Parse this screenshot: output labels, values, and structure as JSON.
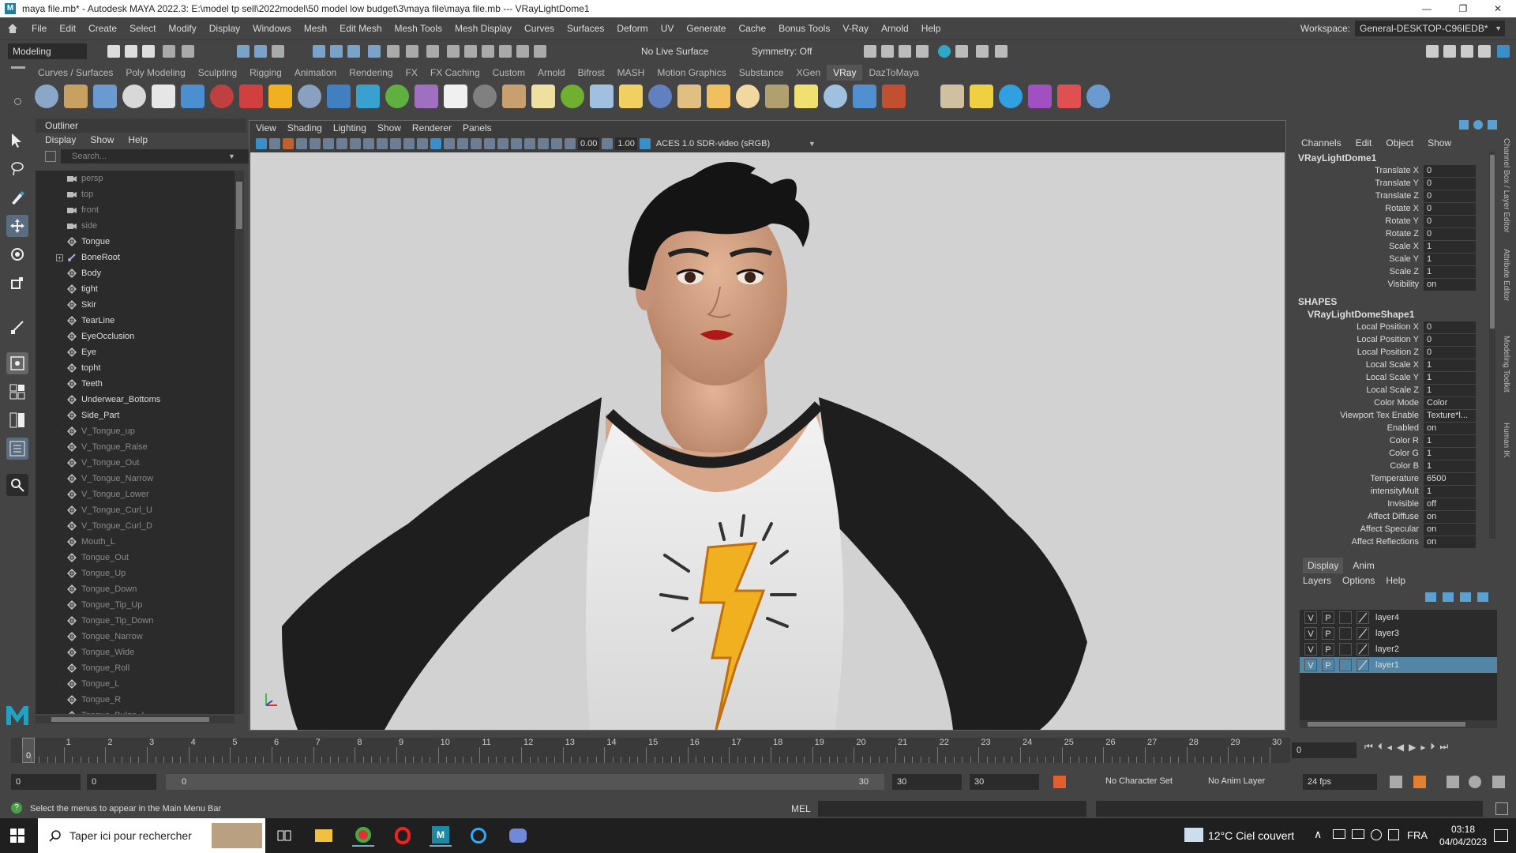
{
  "window": {
    "title": "maya file.mb* - Autodesk MAYA 2022.3: E:\\model tp sell\\2022model\\50 model low budget\\3\\maya file\\maya file.mb  ---  VRayLightDome1",
    "minimize": "—",
    "maximize": "❐",
    "close": "✕"
  },
  "menubar": {
    "items": [
      "File",
      "Edit",
      "Create",
      "Select",
      "Modify",
      "Display",
      "Windows",
      "Mesh",
      "Edit Mesh",
      "Mesh Tools",
      "Mesh Display",
      "Curves",
      "Surfaces",
      "Deform",
      "UV",
      "Generate",
      "Cache",
      "Bonus Tools",
      "V-Ray",
      "Arnold",
      "Help"
    ],
    "workspace_label": "Workspace:",
    "workspace_value": "General-DESKTOP-C96IEDB*"
  },
  "statusline": {
    "menuset": "Modeling",
    "live_surface": "No Live Surface",
    "symmetry": "Symmetry: Off"
  },
  "shelf": {
    "tabs": [
      "Curves / Surfaces",
      "Poly Modeling",
      "Sculpting",
      "Rigging",
      "Animation",
      "Rendering",
      "FX",
      "FX Caching",
      "Custom",
      "Arnold",
      "Bifrost",
      "MASH",
      "Motion Graphics",
      "Substance",
      "XGen",
      "VRay",
      "DazToMaya"
    ],
    "active_tab": "VRay",
    "button_colors": [
      "#8aa6c8",
      "#c8a060",
      "#6a9ad0",
      "#d8d8d8",
      "#e6e6e6",
      "#4a90d0",
      "#c04040",
      "#d04040",
      "#f0b020",
      "#8aa0c0",
      "#4080c0",
      "#3aa0d0",
      "#60b040",
      "#a070c0",
      "#f0f0f0",
      "#808080",
      "#c8a070",
      "#f0e0a0",
      "#70b030",
      "#a0c0e0",
      "#f0d060",
      "#6080c0",
      "#e0c080",
      "#f0c060",
      "#f0d8a0",
      "#b0a070",
      "#f0e070",
      "#a0c0e0",
      "#5090d0",
      "#c05030",
      "#444444",
      "#d0c0a0",
      "#f0d040",
      "#30a0e0",
      "#a050c0",
      "#e05050",
      "#6a9ad0"
    ]
  },
  "outliner": {
    "title": "Outliner",
    "menu": [
      "Display",
      "Show",
      "Help"
    ],
    "search_placeholder": "Search...",
    "items": [
      {
        "label": "persp",
        "icon": "camera-icon",
        "dim": true
      },
      {
        "label": "top",
        "icon": "camera-icon",
        "dim": true
      },
      {
        "label": "front",
        "icon": "camera-icon",
        "dim": true
      },
      {
        "label": "side",
        "icon": "camera-icon",
        "dim": true
      },
      {
        "label": "Tongue",
        "icon": "mesh-icon",
        "dim": false
      },
      {
        "label": "BoneRoot",
        "icon": "joint-icon",
        "dim": false,
        "expand": "+"
      },
      {
        "label": "Body",
        "icon": "mesh-icon",
        "dim": false
      },
      {
        "label": "tight",
        "icon": "mesh-icon",
        "dim": false
      },
      {
        "label": "Skir",
        "icon": "mesh-icon",
        "dim": false
      },
      {
        "label": "TearLine",
        "icon": "mesh-icon",
        "dim": false
      },
      {
        "label": "EyeOcclusion",
        "icon": "mesh-icon",
        "dim": false
      },
      {
        "label": "Eye",
        "icon": "mesh-icon",
        "dim": false
      },
      {
        "label": "topht",
        "icon": "mesh-icon",
        "dim": false
      },
      {
        "label": "Teeth",
        "icon": "mesh-icon",
        "dim": false
      },
      {
        "label": "Underwear_Bottoms",
        "icon": "mesh-icon",
        "dim": false
      },
      {
        "label": "Side_Part",
        "icon": "mesh-icon",
        "dim": false
      },
      {
        "label": "V_Tongue_up",
        "icon": "mesh-icon",
        "dim": true
      },
      {
        "label": "V_Tongue_Raise",
        "icon": "mesh-icon",
        "dim": true
      },
      {
        "label": "V_Tongue_Out",
        "icon": "mesh-icon",
        "dim": true
      },
      {
        "label": "V_Tongue_Narrow",
        "icon": "mesh-icon",
        "dim": true
      },
      {
        "label": "V_Tongue_Lower",
        "icon": "mesh-icon",
        "dim": true
      },
      {
        "label": "V_Tongue_Curl_U",
        "icon": "mesh-icon",
        "dim": true
      },
      {
        "label": "V_Tongue_Curl_D",
        "icon": "mesh-icon",
        "dim": true
      },
      {
        "label": "Mouth_L",
        "icon": "mesh-icon",
        "dim": true
      },
      {
        "label": "Tongue_Out",
        "icon": "mesh-icon",
        "dim": true
      },
      {
        "label": "Tongue_Up",
        "icon": "mesh-icon",
        "dim": true
      },
      {
        "label": "Tongue_Down",
        "icon": "mesh-icon",
        "dim": true
      },
      {
        "label": "Tongue_Tip_Up",
        "icon": "mesh-icon",
        "dim": true
      },
      {
        "label": "Tongue_Tip_Down",
        "icon": "mesh-icon",
        "dim": true
      },
      {
        "label": "Tongue_Narrow",
        "icon": "mesh-icon",
        "dim": true
      },
      {
        "label": "Tongue_Wide",
        "icon": "mesh-icon",
        "dim": true
      },
      {
        "label": "Tongue_Roll",
        "icon": "mesh-icon",
        "dim": true
      },
      {
        "label": "Tongue_L",
        "icon": "mesh-icon",
        "dim": true
      },
      {
        "label": "Tongue_R",
        "icon": "mesh-icon",
        "dim": true
      },
      {
        "label": "Tongue_Bulge_L",
        "icon": "mesh-icon",
        "dim": true
      }
    ]
  },
  "viewport": {
    "menu": [
      "View",
      "Shading",
      "Lighting",
      "Show",
      "Renderer",
      "Panels"
    ],
    "exposure": "0.00",
    "gamma": "1.00",
    "colorspace": "ACES 1.0 SDR-video (sRGB)"
  },
  "channelbox": {
    "menu": [
      "Channels",
      "Edit",
      "Object",
      "Show"
    ],
    "object": "VRayLightDome1",
    "channels": [
      {
        "label": "Translate X",
        "value": "0"
      },
      {
        "label": "Translate Y",
        "value": "0"
      },
      {
        "label": "Translate Z",
        "value": "0"
      },
      {
        "label": "Rotate X",
        "value": "0"
      },
      {
        "label": "Rotate Y",
        "value": "0"
      },
      {
        "label": "Rotate Z",
        "value": "0"
      },
      {
        "label": "Scale X",
        "value": "1"
      },
      {
        "label": "Scale Y",
        "value": "1"
      },
      {
        "label": "Scale Z",
        "value": "1"
      },
      {
        "label": "Visibility",
        "value": "on"
      }
    ],
    "shapes_label": "SHAPES",
    "shape_name": "VRayLightDomeShape1",
    "shape_channels": [
      {
        "label": "Local Position X",
        "value": "0"
      },
      {
        "label": "Local Position Y",
        "value": "0"
      },
      {
        "label": "Local Position Z",
        "value": "0"
      },
      {
        "label": "Local Scale X",
        "value": "1"
      },
      {
        "label": "Local Scale Y",
        "value": "1"
      },
      {
        "label": "Local Scale Z",
        "value": "1"
      },
      {
        "label": "Color Mode",
        "value": "Color"
      },
      {
        "label": "Viewport Tex Enable",
        "value": "Texture*l..."
      },
      {
        "label": "Enabled",
        "value": "on"
      },
      {
        "label": "Color R",
        "value": "1"
      },
      {
        "label": "Color G",
        "value": "1"
      },
      {
        "label": "Color B",
        "value": "1"
      },
      {
        "label": "Temperature",
        "value": "6500"
      },
      {
        "label": "intensityMult",
        "value": "1"
      },
      {
        "label": "Invisible",
        "value": "off"
      },
      {
        "label": "Affect Diffuse",
        "value": "on"
      },
      {
        "label": "Affect Specular",
        "value": "on"
      },
      {
        "label": "Affect Reflections",
        "value": "on"
      }
    ],
    "side_tabs": [
      "Channel Box / Layer Editor",
      "Attribute Editor",
      "Modeling Toolkit",
      "Human IK"
    ]
  },
  "layers": {
    "tabs": [
      "Display",
      "Anim"
    ],
    "menu": [
      "Layers",
      "Options",
      "Help"
    ],
    "rows": [
      {
        "v": "V",
        "p": "P",
        "name": "layer4",
        "selected": false
      },
      {
        "v": "V",
        "p": "P",
        "name": "layer3",
        "selected": false
      },
      {
        "v": "V",
        "p": "P",
        "name": "layer2",
        "selected": false
      },
      {
        "v": "V",
        "p": "P",
        "name": "layer1",
        "selected": true
      }
    ]
  },
  "timeline": {
    "ticks": [
      "0",
      "1",
      "2",
      "3",
      "4",
      "5",
      "6",
      "7",
      "8",
      "9",
      "10",
      "11",
      "12",
      "13",
      "14",
      "15",
      "16",
      "17",
      "18",
      "19",
      "20",
      "21",
      "22",
      "23",
      "24",
      "25",
      "26",
      "27",
      "28",
      "29",
      "30"
    ],
    "current_frame": "0",
    "current_frame_field": "0"
  },
  "range": {
    "start": "0",
    "anim_start": "0",
    "slider_start": "0",
    "slider_end": "30",
    "anim_end": "30",
    "end": "30",
    "character_set": "No Character Set",
    "anim_layer": "No Anim Layer",
    "fps": "24 fps"
  },
  "commandline": {
    "help_text": "Select the menus to appear in the Main Menu Bar",
    "lang": "MEL"
  },
  "taskbar": {
    "search_placeholder": "Taper ici pour rechercher",
    "weather": "12°C  Ciel couvert",
    "lang": "FRA",
    "time": "03:18",
    "date": "04/04/2023"
  },
  "colors": {
    "accent": "#5285a6",
    "panel": "#444444",
    "field": "#2b2b2b",
    "viewport_bg": "#d2d2d2"
  }
}
